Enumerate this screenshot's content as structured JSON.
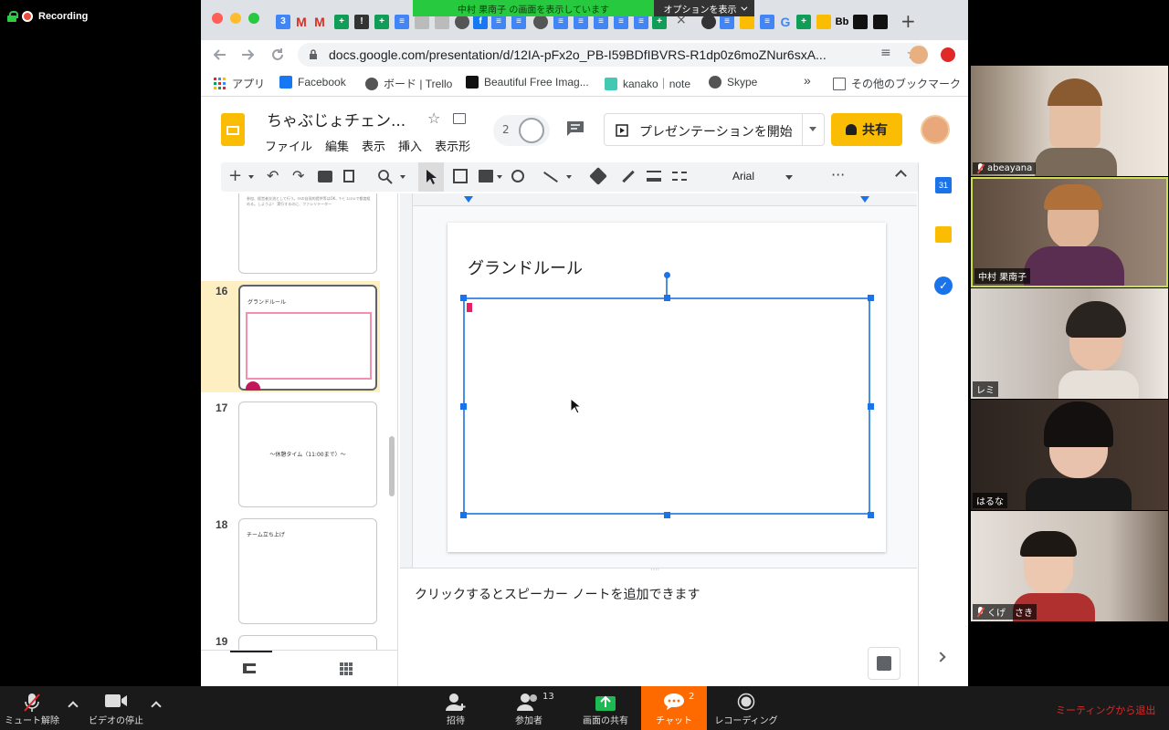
{
  "recording": {
    "label": "Recording"
  },
  "share_banner": {
    "text": "中村 果南子 の画面を表示しています",
    "options": "オプションを表示"
  },
  "browser": {
    "url": "docs.google.com/presentation/d/12IA-pFx2o_PB-I59BDfIBVRS-R1dp0z6moZNur6sxA...",
    "bookmarks": [
      "アプリ",
      "Facebook",
      "ボード | Trello",
      "Beautiful Free Imag...",
      "kanako｜note",
      "Skype"
    ],
    "more": "»",
    "other_bookmarks": "その他のブックマーク"
  },
  "slides": {
    "title": "ちゃぶじょチェン...",
    "menu": [
      "ファイル",
      "編集",
      "表示",
      "挿入",
      "表示形"
    ],
    "collab_count": "2",
    "present_label": "プレゼンテーションを開始",
    "share_label": "共有",
    "font": "Arial",
    "thumbnails": [
      {
        "num": "",
        "text": "参加、経営者交流として行う。ﾁﾙの自発的提供等はOK、ｻｰﾋﾞｽｼｽﾃﾑで都度組める。しようよ！ 実行するのに、ファシリテーター"
      },
      {
        "num": "16",
        "text": "グランドルール"
      },
      {
        "num": "17",
        "text": "〜休憩タイム（11:00まで）〜"
      },
      {
        "num": "18",
        "text": "チーム立ち上げ"
      },
      {
        "num": "19",
        "text": ""
      }
    ],
    "slide_title": "グランドルール",
    "notes_placeholder": "クリックするとスピーカー ノートを追加できます"
  },
  "participants": [
    {
      "name": "abeayana",
      "muted": true,
      "bg": "#a89680"
    },
    {
      "name": "中村 果南子",
      "muted": false,
      "bg": "#8a7060"
    },
    {
      "name": "レミ",
      "muted": false,
      "bg": "#b8aea6"
    },
    {
      "name": "はるな",
      "muted": false,
      "bg": "#4a3a30"
    },
    {
      "name": "くげ　さき",
      "muted": true,
      "bg": "#c9c0b8"
    }
  ],
  "zoom": {
    "unmute": "ミュート解除",
    "stop_video": "ビデオの停止",
    "invite": "招待",
    "participants": "参加者",
    "participants_count": "13",
    "share_screen": "画面の共有",
    "chat": "チャット",
    "chat_badge": "2",
    "record": "レコーディング",
    "leave": "ミーティングから退出"
  },
  "colors": {
    "accent": "#fbbc04",
    "selection": "#1a73e8",
    "chat": "#ff6a00",
    "leave": "#e02828"
  }
}
